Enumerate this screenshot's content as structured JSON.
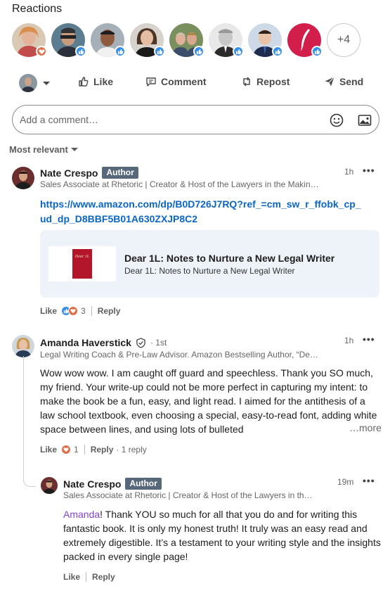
{
  "reactions": {
    "title": "Reactions",
    "more_count": "+4"
  },
  "actions": {
    "like": "Like",
    "comment": "Comment",
    "repost": "Repost",
    "send": "Send"
  },
  "comment_box": {
    "placeholder": "Add a comment…"
  },
  "sort": {
    "label": "Most relevant"
  },
  "comments": [
    {
      "author": "Nate Crespo",
      "badge": "Author",
      "headline": "Sales Associate at Rhetoric | Creator & Host of the Lawyers in the Makin…",
      "time": "1h",
      "link": "https://www.amazon.com/dp/B0D726J7RQ?ref_=cm_sw_r_ffobk_cp_ud_dp_D8BBF5B01A630ZXJP8C2",
      "card_title": "Dear 1L: Notes to Nurture a New Legal Writer",
      "card_subtitle": "Dear 1L: Notes to Nurture a New Legal Writer",
      "book_cover_text": "Dear 1L",
      "like_label": "Like",
      "reaction_count": "3",
      "reply_label": "Reply"
    },
    {
      "author": "Amanda Haverstick",
      "degree": "· 1st",
      "headline": "Legal Writing Coach & Pre-Law Advisor. Amazon Bestselling Author, “De…",
      "time": "1h",
      "body": "Wow wow wow. I am caught off guard and speechless. Thank you SO much, my friend. Your write-up could not be more perfect in capturing my intent: to make the book be a fun, easy, and light read. I aimed for the antithesis of a law school textbook, even choosing a special, easy-to-read font, adding white space between lines, and using lots of bulleted",
      "more": "…more",
      "like_label": "Like",
      "reaction_count": "1",
      "reply_label": "Reply",
      "replies_label": "· 1 reply"
    },
    {
      "author": "Nate Crespo",
      "badge": "Author",
      "headline": "Sales Associate at Rhetoric | Creator & Host of the Lawyers in th…",
      "time": "19m",
      "mention": "Amanda",
      "body": "! Thank YOU so much for all that you do and for writing this fantastic book. It is only my honest truth! It truly was an easy read and extremely digestible. It’s a testament to your writing style and the insights packed in every single page!",
      "like_label": "Like",
      "reply_label": "Reply"
    }
  ],
  "colors": {
    "link": "#0a66c2",
    "like_badge": "#378fe9",
    "love_badge": "#df704d",
    "author_badge": "#56687a",
    "mention": "#8344cc"
  }
}
